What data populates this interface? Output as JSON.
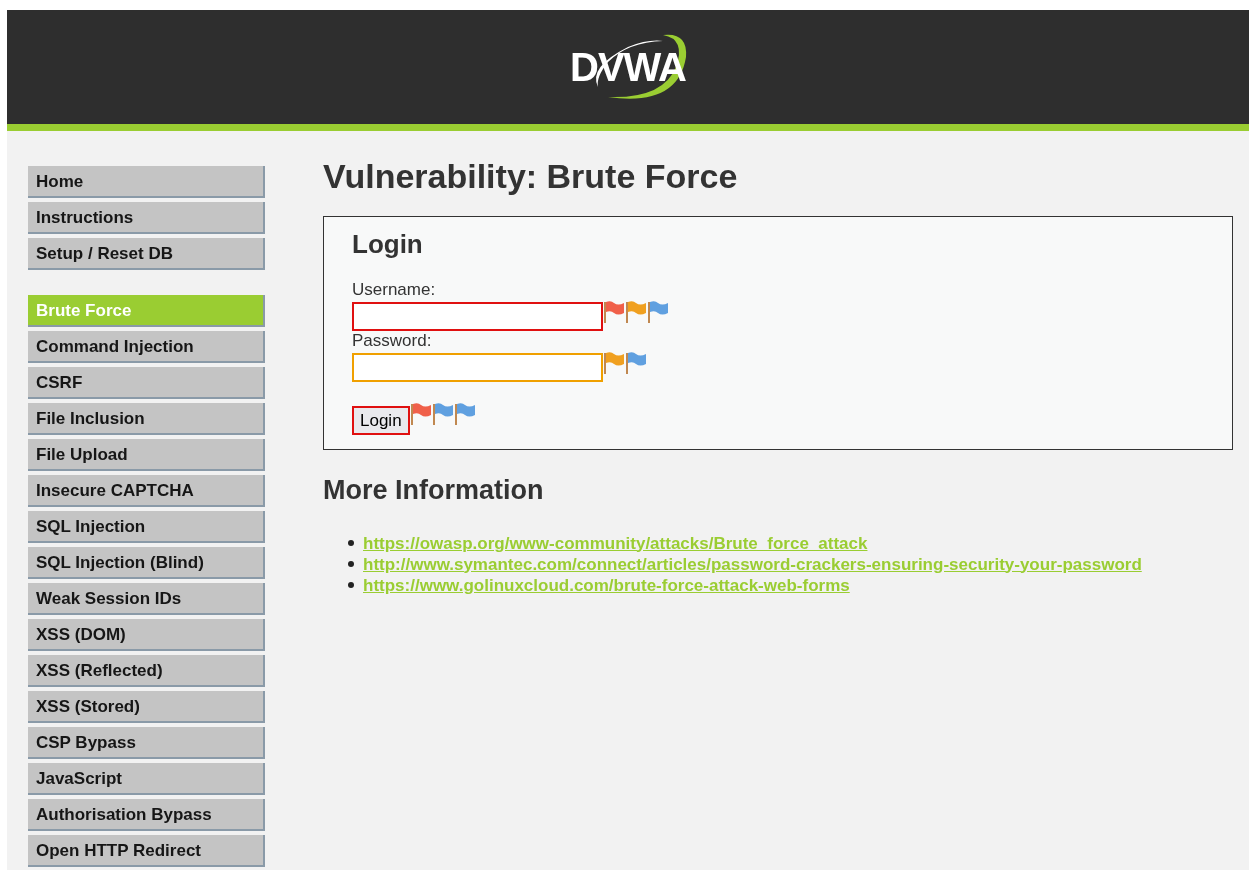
{
  "header": {
    "logo": "DVWA"
  },
  "sidebar": {
    "groups": [
      {
        "items": [
          {
            "label": "Home",
            "selected": false
          },
          {
            "label": "Instructions",
            "selected": false
          },
          {
            "label": "Setup / Reset DB",
            "selected": false
          }
        ]
      },
      {
        "items": [
          {
            "label": "Brute Force",
            "selected": true
          },
          {
            "label": "Command Injection",
            "selected": false
          },
          {
            "label": "CSRF",
            "selected": false
          },
          {
            "label": "File Inclusion",
            "selected": false
          },
          {
            "label": "File Upload",
            "selected": false
          },
          {
            "label": "Insecure CAPTCHA",
            "selected": false
          },
          {
            "label": "SQL Injection",
            "selected": false
          },
          {
            "label": "SQL Injection (Blind)",
            "selected": false
          },
          {
            "label": "Weak Session IDs",
            "selected": false
          },
          {
            "label": "XSS (DOM)",
            "selected": false
          },
          {
            "label": "XSS (Reflected)",
            "selected": false
          },
          {
            "label": "XSS (Stored)",
            "selected": false
          },
          {
            "label": "CSP Bypass",
            "selected": false
          },
          {
            "label": "JavaScript",
            "selected": false
          },
          {
            "label": "Authorisation Bypass",
            "selected": false
          },
          {
            "label": "Open HTTP Redirect",
            "selected": false
          }
        ]
      }
    ]
  },
  "main": {
    "title": "Vulnerability: Brute Force",
    "login": {
      "heading": "Login",
      "fields": [
        {
          "label": "Username:",
          "color": "#e01010",
          "flags": [
            {
              "color": "#f0604a"
            },
            {
              "color": "#f0a020"
            },
            {
              "color": "#60a0e0"
            }
          ]
        },
        {
          "label": "Password:",
          "color": "#f0a000",
          "flags": [
            {
              "color": "#f0a020"
            },
            {
              "color": "#60a0e0"
            }
          ]
        }
      ],
      "button": {
        "label": "Login",
        "color": "#e01010",
        "flags": [
          {
            "color": "#f0604a"
          },
          {
            "color": "#60a0e0"
          },
          {
            "color": "#60a0e0"
          }
        ]
      }
    },
    "more_info": {
      "heading": "More Information",
      "links": [
        "https://owasp.org/www-community/attacks/Brute_force_attack",
        "http://www.symantec.com/connect/articles/password-crackers-ensuring-security-your-password",
        "https://www.golinuxcloud.com/brute-force-attack-web-forms"
      ]
    }
  }
}
